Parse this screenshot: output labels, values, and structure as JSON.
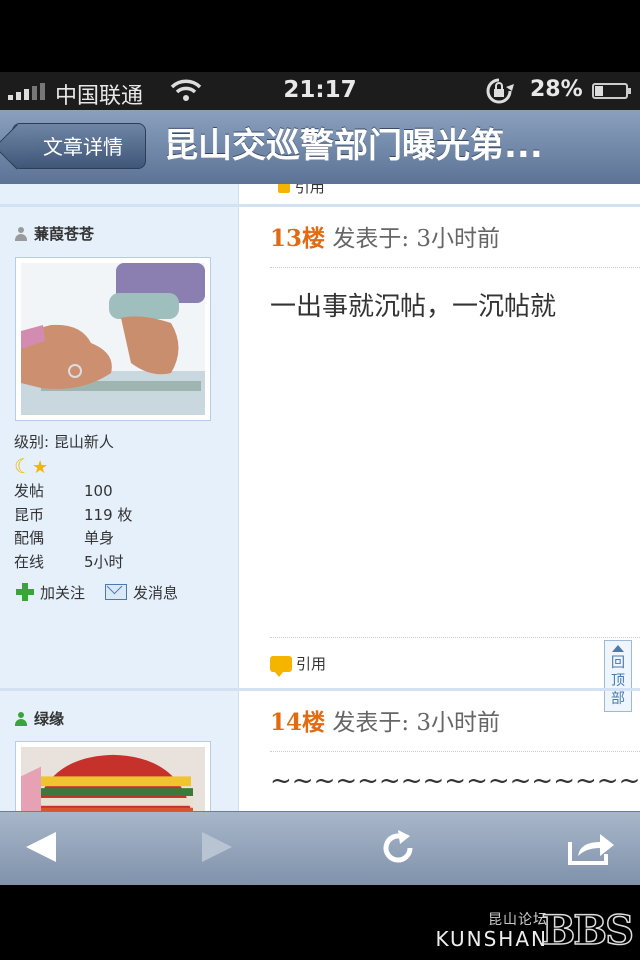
{
  "status_bar": {
    "carrier": "中国联通",
    "time": "21:17",
    "battery": "28%",
    "battery_level": 0.28
  },
  "nav": {
    "back_label": "文章详情",
    "title": "昆山交巡警部门曝光第..."
  },
  "prev_post_fragment": "引用",
  "posts": [
    {
      "username": "蒹葭苍苍",
      "user_status_color": "#9a9a9a",
      "level_label": "级别: 昆山新人",
      "stats": [
        {
          "k": "发帖",
          "v": "100"
        },
        {
          "k": "昆币",
          "v": "119 枚"
        },
        {
          "k": "配偶",
          "v": "单身"
        },
        {
          "k": "在线",
          "v": "5小时"
        }
      ],
      "follow_label": "加关注",
      "message_label": "发消息",
      "floor": "13楼",
      "posted": "发表于: 3小时前",
      "text": "一出事就沉帖，一沉帖就",
      "quote_label": "引用"
    },
    {
      "username": "绿缘",
      "user_status_color": "#3aa33a",
      "floor": "14楼",
      "posted": "发表于: 3小时前",
      "text": "~~~~~~~~~~~~~~~~~~~~~~~~~~~~~~"
    }
  ],
  "back_to_top": {
    "chars": [
      "回",
      "顶",
      "部"
    ]
  },
  "footer": {
    "brand_cn": "昆山论坛",
    "brand_en": "KUNSHAN",
    "brand_bbs": "BBS"
  }
}
